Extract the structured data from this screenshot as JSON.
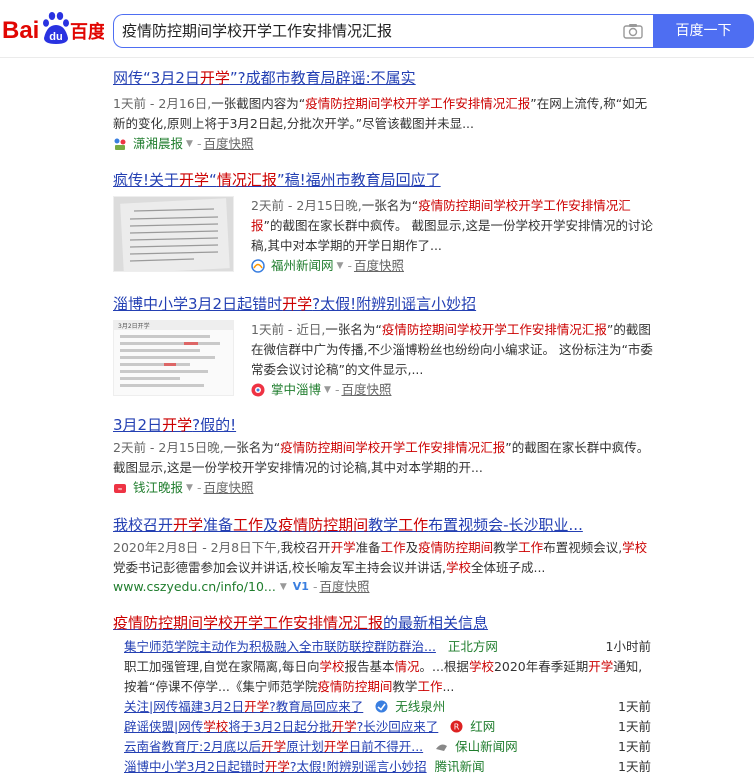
{
  "search": {
    "query": "疫情防控期间学校开学工作安排情况汇报",
    "button_label": "百度一下"
  },
  "logo": {
    "text_left": "Bai",
    "paw": "du",
    "text_right": "百度"
  },
  "results": [
    {
      "title_parts": [
        [
          "网传“3月2日",
          ""
        ],
        [
          "开学",
          "em"
        ],
        [
          "”?成都市教育局辟谣:不属实",
          ""
        ]
      ],
      "date": "1天前 - 2月16日,",
      "abstract_parts": [
        [
          "一张截图内容为“",
          ""
        ],
        [
          "疫情防控期间学校开学工作安排情况汇报",
          "em"
        ],
        [
          "”在网上流传,称“如无新的变化,原则上将于3月2日起,分批次开学。”尽管该截图并未显...",
          ""
        ]
      ],
      "source": "潇湘晨报",
      "snapshot": "百度快照"
    },
    {
      "title_parts": [
        [
          "疯传!关于",
          ""
        ],
        [
          "开学",
          "em"
        ],
        [
          "“",
          ""
        ],
        [
          "情况汇报",
          "em"
        ],
        [
          "”稿!福州市教育局回应了",
          ""
        ]
      ],
      "date": "2天前 - 2月15日晚,",
      "abstract_parts": [
        [
          "一张名为“",
          ""
        ],
        [
          "疫情防控期间学校开学工作安排情况汇报",
          "em"
        ],
        [
          "”的截图在家长群中疯传。 截图显示,这是一份学校开学安排情况的讨论稿,其中对本学期的开学日期作了...",
          ""
        ]
      ],
      "source": "福州新闻网",
      "snapshot": "百度快照"
    },
    {
      "title_parts": [
        [
          "淄博中小学3月2日起错时",
          ""
        ],
        [
          "开学",
          "em"
        ],
        [
          "?太假!附辨别谣言小妙招",
          ""
        ]
      ],
      "date": "1天前 - 近日,",
      "abstract_parts": [
        [
          "一张名为“",
          ""
        ],
        [
          "疫情防控期间学校开学工作安排情况汇报",
          "em"
        ],
        [
          "”的截图在微信群中广为传播,不少淄博粉丝也纷纷向小编求证。 这份标注为“市委常委会议讨论稿”的文件显示,...",
          ""
        ]
      ],
      "source": "掌中淄博",
      "snapshot": "百度快照",
      "thumb_heading": "3月2日开学"
    },
    {
      "title_parts": [
        [
          "3月2日",
          ""
        ],
        [
          "开学",
          "em"
        ],
        [
          "?假的!",
          ""
        ]
      ],
      "date": "2天前 - 2月15日晚,",
      "abstract_parts": [
        [
          "一张名为“",
          ""
        ],
        [
          "疫情防控期间学校开学工作安排情况汇报",
          "em"
        ],
        [
          "”的截图在家长群中疯传。 截图显示,这是一份学校开学安排情况的讨论稿,其中对本学期的开...",
          ""
        ]
      ],
      "source": "钱江晚报",
      "snapshot": "百度快照"
    },
    {
      "title_parts": [
        [
          "我校召开",
          ""
        ],
        [
          "开学",
          "em"
        ],
        [
          "准备",
          ""
        ],
        [
          "工作",
          "em"
        ],
        [
          "及",
          ""
        ],
        [
          "疫情防控期间",
          "em"
        ],
        [
          "教学",
          ""
        ],
        [
          "工作",
          "em"
        ],
        [
          "布置视频会-长沙职业...",
          ""
        ]
      ],
      "date": "2020年2月8日 - 2月8日下午,",
      "abstract_parts": [
        [
          "我校召开",
          ""
        ],
        [
          "开学",
          "em"
        ],
        [
          "准备",
          ""
        ],
        [
          "工作",
          "em"
        ],
        [
          "及",
          ""
        ],
        [
          "疫情防控期间",
          "em"
        ],
        [
          "教学",
          ""
        ],
        [
          "工作",
          "em"
        ],
        [
          "布置视频会议,",
          ""
        ],
        [
          "学校",
          "em"
        ],
        [
          "党委书记彭德雷参加会议并讲话,校长喻友军主持会议并讲话,",
          ""
        ],
        [
          "学校",
          "em"
        ],
        [
          "全体班子成...",
          ""
        ]
      ],
      "url": "www.cszyedu.cn/info/10...",
      "snapshot": "百度快照"
    }
  ],
  "news": {
    "title_parts": [
      [
        "疫情防控期间学校开学工作安排情况汇报",
        "em"
      ],
      [
        "的最新相关信息",
        ""
      ]
    ],
    "items": [
      {
        "parts": [
          [
            "集宁师范学院主动作为积极融入全市联防联控群防群治...",
            ""
          ]
        ],
        "source": "正北方网",
        "time": "1小时前"
      },
      {
        "parts": [
          [
            "关注|网传福建3月2日",
            ""
          ],
          [
            "开学",
            "em"
          ],
          [
            "?教育局回应来了",
            ""
          ]
        ],
        "source": "无线泉州",
        "time": "1天前"
      },
      {
        "parts": [
          [
            "辟谣侠盟|网传",
            ""
          ],
          [
            "学校",
            "em"
          ],
          [
            "将于3月2日起分批",
            ""
          ],
          [
            "开学",
            "em"
          ],
          [
            "?长沙回应来了",
            ""
          ]
        ],
        "source": "红网",
        "time": "1天前"
      },
      {
        "parts": [
          [
            "云南省教育厅:2月底以后",
            ""
          ],
          [
            "开学",
            "em"
          ],
          [
            "原计划",
            ""
          ],
          [
            "开学",
            "em"
          ],
          [
            "日前不得开...",
            ""
          ]
        ],
        "source": "保山新闻网",
        "time": "1天前"
      },
      {
        "parts": [
          [
            "淄博中小学3月2日起错时",
            ""
          ],
          [
            "开学",
            "em"
          ],
          [
            "?太假!附辨别谣言小妙招",
            ""
          ]
        ],
        "source": "腾讯新闻",
        "time": "1天前"
      }
    ],
    "desc_parts": [
      [
        "职工加强管理,自觉在家隔离,每日向",
        ""
      ],
      [
        "学校",
        "em"
      ],
      [
        "报告",
        ""
      ],
      [
        "基本",
        ""
      ],
      [
        "情况",
        "em"
      ],
      [
        "。...根据",
        ""
      ],
      [
        "学校",
        "em"
      ],
      [
        "2020年春季延期",
        ""
      ],
      [
        "开学",
        "em"
      ],
      [
        "通知,按着“停课不停学...《集宁师范学院",
        ""
      ],
      [
        "疫情防控期间",
        "em"
      ],
      [
        "教学",
        ""
      ],
      [
        "工作",
        "em"
      ],
      [
        "...",
        ""
      ]
    ]
  }
}
